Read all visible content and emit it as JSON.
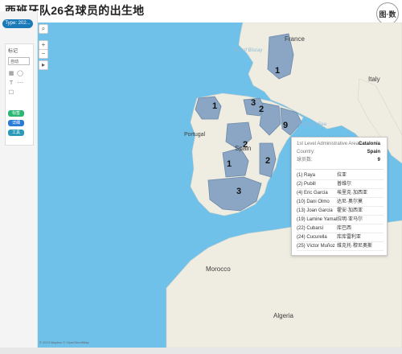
{
  "header": {
    "title": "西班牙队26名球员的出生地",
    "logo_text": "图·数"
  },
  "sidebar": {
    "type_pill": "Type: 202...",
    "panel_label": "标记",
    "select_value": "自动",
    "chips": [
      "标签",
      "详细",
      "工具"
    ]
  },
  "map": {
    "countries": [
      {
        "name": "France",
        "big": true
      },
      {
        "name": "Italy",
        "big": true
      },
      {
        "name": "Portugal",
        "big": false
      },
      {
        "name": "Spain",
        "big": true
      },
      {
        "name": "Morocco",
        "big": true
      },
      {
        "name": "Algeria",
        "big": true
      }
    ],
    "seas": [
      {
        "name": "Bay of Biscay"
      },
      {
        "name": "Balearic Sea"
      }
    ],
    "region_counts": [
      {
        "region": "Basque Country",
        "count": "1"
      },
      {
        "region": "Navarre",
        "count": "3"
      },
      {
        "region": "Aragon",
        "count": "2"
      },
      {
        "region": "Catalonia",
        "count": "9"
      },
      {
        "region": "Galicia",
        "count": "1"
      },
      {
        "region": "Castile and León",
        "count": "2"
      },
      {
        "region": "Valencia",
        "count": "2"
      },
      {
        "region": "Madrid",
        "count": "1"
      },
      {
        "region": "Andalusia",
        "count": "3"
      },
      {
        "region": "Pays Basque",
        "count": "1"
      }
    ],
    "credit": "© 2024 Mapbox © OpenStreetMap"
  },
  "tooltip": {
    "region_label": "1st Level Administrative Areas:",
    "region_value": "Catalonia",
    "country_label": "Country:",
    "country_value": "Spain",
    "count_label": "球员数:",
    "count_value": "9",
    "players": [
      {
        "en": "(1) Raya",
        "zh": "拉亚"
      },
      {
        "en": "(2) Pubill",
        "zh": "普维尔"
      },
      {
        "en": "(4) Eric Garcia",
        "zh": "埃里克·加西亚"
      },
      {
        "en": "(10) Dani Olmo",
        "zh": "达尼·奥尔莫"
      },
      {
        "en": "(13) Joan Garcia",
        "zh": "霍安·加西亚"
      },
      {
        "en": "(19) Lamine Yamal",
        "zh": "拉明·亚马尔"
      },
      {
        "en": "(22) Cubarsí",
        "zh": "库巴西"
      },
      {
        "en": "(24) Cucurella",
        "zh": "库库雷利亚"
      },
      {
        "en": "(25) Víctor Muñoz",
        "zh": "维克托·穆尼奥斯"
      }
    ]
  },
  "colors": {
    "sea": "#6fc1e9",
    "land": "#efece2",
    "highlight": "#8aa6c4",
    "highlight_stroke": "#6d88a8"
  }
}
